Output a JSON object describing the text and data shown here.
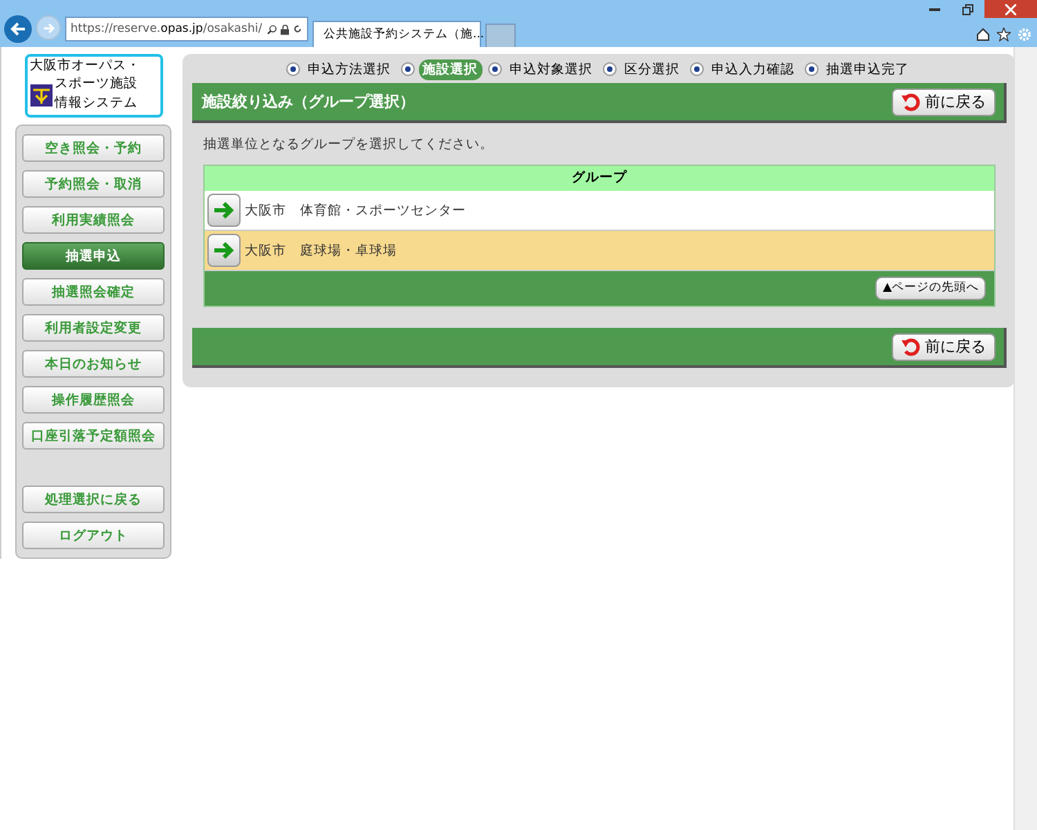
{
  "browser": {
    "url_prefix": "https://reserve.",
    "url_host": "opas.jp",
    "url_path": "/osakashi/",
    "tab_title": "公共施設予約システム（施..."
  },
  "logo": {
    "line_1": "大阪市オーパス・",
    "line_2": "スポーツ施設",
    "line_3": "情報システム"
  },
  "menu": [
    {
      "label": "空き照会・予約",
      "selected": false
    },
    {
      "label": "予約照会・取消",
      "selected": false
    },
    {
      "label": "利用実績照会",
      "selected": false
    },
    {
      "label": "抽選申込",
      "selected": true
    },
    {
      "label": "抽選照会確定",
      "selected": false
    },
    {
      "label": "利用者設定変更",
      "selected": false
    },
    {
      "label": "本日のお知らせ",
      "selected": false
    },
    {
      "label": "操作履歴照会",
      "selected": false
    },
    {
      "label": "口座引落予定額照会",
      "selected": false
    }
  ],
  "menu_bottom": [
    {
      "label": "処理選択に戻る"
    },
    {
      "label": "ログアウト"
    }
  ],
  "steps": [
    {
      "label": "申込方法選択",
      "selected": false
    },
    {
      "label": "施設選択",
      "selected": true
    },
    {
      "label": "申込対象選択",
      "selected": false
    },
    {
      "label": "区分選択",
      "selected": false
    },
    {
      "label": "申込入力確認",
      "selected": false
    },
    {
      "label": "抽選申込完了",
      "selected": false
    }
  ],
  "header": {
    "title": "施設絞り込み（グループ選択）",
    "back_button": "前に戻る"
  },
  "instruction": "抽選単位となるグループを選択してください。",
  "table": {
    "column": "グループ",
    "rows": [
      {
        "text": "大阪市　体育館・スポーツセンター",
        "highlighted": false
      },
      {
        "text": "大阪市　庭球場・卓球場",
        "highlighted": true
      }
    ],
    "top_button": "▲ページの先頭へ"
  },
  "footer": {
    "back_button": "前に戻る"
  }
}
